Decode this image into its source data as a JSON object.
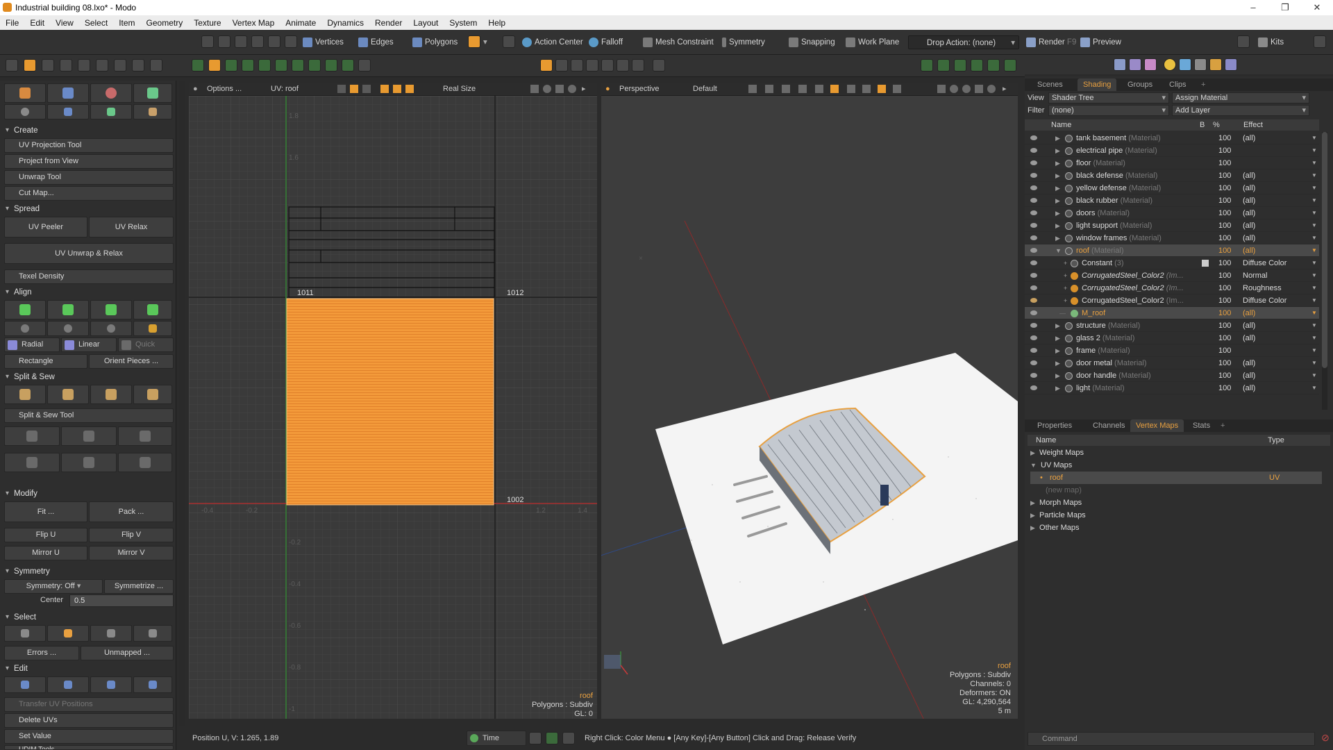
{
  "window": {
    "title": "Industrial building 08.lxo* - Modo",
    "minimize": "–",
    "maximize": "❐",
    "close": "✕"
  },
  "menu": [
    "File",
    "Edit",
    "View",
    "Select",
    "Item",
    "Geometry",
    "Texture",
    "Vertex Map",
    "Animate",
    "Dynamics",
    "Render",
    "Layout",
    "System",
    "Help"
  ],
  "toolbar": {
    "vertices": "Vertices",
    "edges": "Edges",
    "polygons": "Polygons",
    "action_center": "Action Center",
    "falloff": "Falloff",
    "mesh_constraint": "Mesh Constraint",
    "symmetry": "Symmetry",
    "snapping": "Snapping",
    "work_plane": "Work Plane",
    "drop_action": "Drop Action: (none)",
    "render": "Render",
    "render_key": "F9",
    "preview": "Preview",
    "kits": "Kits"
  },
  "left_panel": {
    "create": {
      "title": "Create",
      "items": [
        "UV Projection Tool",
        "Project from View",
        "Unwrap Tool",
        "Cut Map..."
      ]
    },
    "spread": {
      "title": "Spread",
      "uv_peeler": "UV Peeler",
      "uv_relax": "UV Relax",
      "uv_unwrap_relax": "UV Unwrap & Relax",
      "texel_density": "Texel Density"
    },
    "align": {
      "title": "Align",
      "radial": "Radial",
      "linear": "Linear",
      "quick": "Quick",
      "rectangle": "Rectangle",
      "orient_pieces": "Orient Pieces ..."
    },
    "split_sew": {
      "title": "Split & Sew",
      "tool": "Split & Sew Tool"
    },
    "modify": {
      "title": "Modify",
      "fit": "Fit ...",
      "pack": "Pack ...",
      "flip_u": "Flip U",
      "flip_v": "Flip V",
      "mirror_u": "Mirror U",
      "mirror_v": "Mirror V"
    },
    "symmetry": {
      "title": "Symmetry",
      "dropdown": "Symmetry: Off",
      "symmetrize": "Symmetrize ...",
      "center_label": "Center",
      "center_value": "0.5"
    },
    "select": {
      "title": "Select",
      "errors": "Errors ...",
      "unmapped": "Unmapped ..."
    },
    "edit": {
      "title": "Edit",
      "transfer": "Transfer UV Positions",
      "delete_uvs": "Delete UVs",
      "set_value": "Set Value",
      "cut_off": "UDIM Tools"
    }
  },
  "uv_view": {
    "options": "Options ...",
    "uv_map": "UV: roof",
    "real_size": "Real Size",
    "tile_labels": [
      "1011",
      "1012",
      "1002"
    ],
    "v_ticks": [
      "1.8",
      "1.6",
      "-0.2",
      "-0.4",
      "-0.6",
      "-0.8",
      "-1"
    ],
    "u_ticks": [
      "-0.4",
      "-0.2",
      "1.2",
      "1.4"
    ],
    "info_name": "roof",
    "info_polys": "Polygons : Subdiv",
    "info_gl": "GL: 0"
  },
  "persp_view": {
    "mode": "Perspective",
    "shading": "Default",
    "info_name": "roof",
    "info_polys": "Polygons : Subdiv",
    "info_channels": "Channels: 0",
    "info_deformers": "Deformers: ON",
    "info_gl": "GL: 4,290,564",
    "info_scale": "5 m"
  },
  "shader_panel": {
    "tabs": [
      "Scenes",
      "Shading",
      "Groups",
      "Clips"
    ],
    "active_tab": "Shading",
    "view_label": "View",
    "view_value": "Shader Tree",
    "assign": "Assign Material",
    "filter_label": "Filter",
    "filter_value": "(none)",
    "add_layer": "Add Layer",
    "col_name": "Name",
    "col_b": "B",
    "col_pct": "%",
    "col_effect": "Effect",
    "rows": [
      {
        "name": "tank basement",
        "type": "(Material)",
        "pct": "100",
        "effect": "(all)"
      },
      {
        "name": "electrical pipe",
        "type": "(Material)",
        "pct": "100",
        "effect": ""
      },
      {
        "name": "floor",
        "type": "(Material)",
        "pct": "100",
        "effect": ""
      },
      {
        "name": "black defense",
        "type": "(Material)",
        "pct": "100",
        "effect": "(all)"
      },
      {
        "name": "yellow defense",
        "type": "(Material)",
        "pct": "100",
        "effect": "(all)"
      },
      {
        "name": "black rubber",
        "type": "(Material)",
        "pct": "100",
        "effect": "(all)"
      },
      {
        "name": "doors",
        "type": "(Material)",
        "pct": "100",
        "effect": "(all)"
      },
      {
        "name": "light support",
        "type": "(Material)",
        "pct": "100",
        "effect": "(all)"
      },
      {
        "name": "window frames",
        "type": "(Material)",
        "pct": "100",
        "effect": "(all)"
      },
      {
        "name": "roof",
        "type": "(Material)",
        "pct": "100",
        "effect": "(all)"
      },
      {
        "name": "Constant",
        "type": "(3)",
        "pct": "100",
        "effect": "Diffuse Color"
      },
      {
        "name": "CorrugatedSteel_Color2",
        "type": "(Im...",
        "pct": "100",
        "effect": "Normal"
      },
      {
        "name": "CorrugatedSteel_Color2",
        "type": "(Im...",
        "pct": "100",
        "effect": "Roughness"
      },
      {
        "name": "CorrugatedSteel_Color2",
        "type": "(Im...",
        "pct": "100",
        "effect": "Diffuse Color"
      },
      {
        "name": "M_roof",
        "type": "",
        "pct": "100",
        "effect": "(all)"
      },
      {
        "name": "structure",
        "type": "(Material)",
        "pct": "100",
        "effect": "(all)"
      },
      {
        "name": "glass 2",
        "type": "(Material)",
        "pct": "100",
        "effect": "(all)"
      },
      {
        "name": "frame",
        "type": "(Material)",
        "pct": "100",
        "effect": ""
      },
      {
        "name": "door metal",
        "type": "(Material)",
        "pct": "100",
        "effect": "(all)"
      },
      {
        "name": "door handle",
        "type": "(Material)",
        "pct": "100",
        "effect": "(all)"
      },
      {
        "name": "light",
        "type": "(Material)",
        "pct": "100",
        "effect": "(all)"
      }
    ]
  },
  "vmap_panel": {
    "tabs": [
      "Properties",
      "Channels",
      "Vertex Maps",
      "Stats"
    ],
    "active_tab": "Vertex Maps",
    "col_name": "Name",
    "col_type": "Type",
    "items": {
      "weight": "Weight Maps",
      "uv": "UV Maps",
      "roof": "roof",
      "roof_type": "UV",
      "new_map": "(new map)",
      "morph": "Morph Maps",
      "particle": "Particle Maps",
      "other": "Other Maps"
    }
  },
  "status": {
    "position": "Position U, V:   1.265, 1.89",
    "time": "Time",
    "hint": "Right Click: Color Menu ● [Any Key]-[Any Button] Click and Drag: Release Verify",
    "command_placeholder": "Command"
  },
  "colors": {
    "accent": "#e8a040",
    "selection": "#f0a040",
    "uv_fill": "#f39a3a"
  }
}
